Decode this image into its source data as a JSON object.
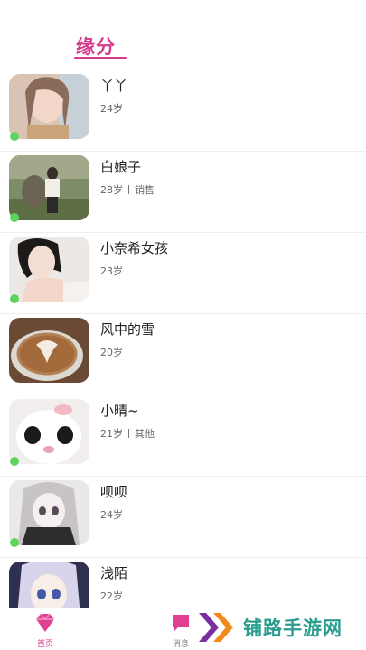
{
  "header": {
    "title": "缘分"
  },
  "users": [
    {
      "name": "丫丫",
      "age": "24岁",
      "occupation": ""
    },
    {
      "name": "白娘子",
      "age": "28岁",
      "occupation": "销售"
    },
    {
      "name": "小奈希女孩",
      "age": "23岁",
      "occupation": ""
    },
    {
      "name": "风中的雪",
      "age": "20岁",
      "occupation": ""
    },
    {
      "name": "小晴~",
      "age": "21岁",
      "occupation": "其他"
    },
    {
      "name": "呗呗",
      "age": "24岁",
      "occupation": ""
    },
    {
      "name": "浅陌",
      "age": "22岁",
      "occupation": ""
    }
  ],
  "tabbar": {
    "home_label": "首页",
    "messages_label": "消息",
    "home_icon": "diamond-icon",
    "messages_icon": "chat-bubble-icon"
  },
  "watermark": {
    "text": "铺路手游网"
  },
  "colors": {
    "accent": "#d63a8d",
    "online": "#5fd35f",
    "watermark": "#2a9d8f"
  }
}
